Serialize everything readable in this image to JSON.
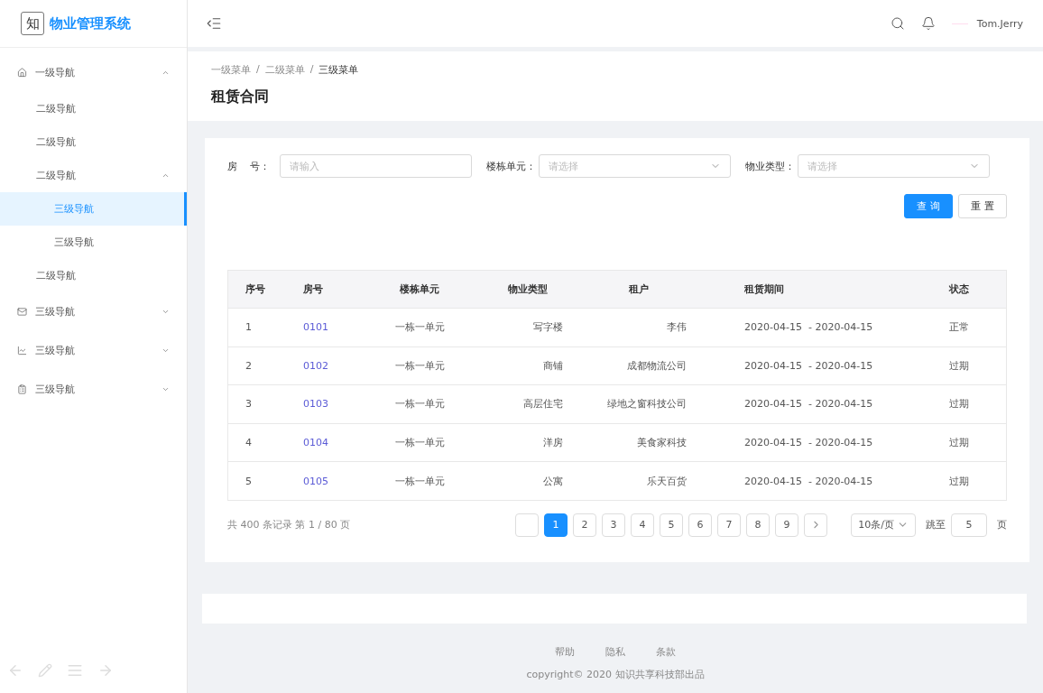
{
  "brand": {
    "logo": "知",
    "title": "物业管理系统"
  },
  "sidebar": {
    "items": [
      {
        "label": "一级导航",
        "expanded": true,
        "selected": false,
        "children": [
          {
            "label": "二级导航",
            "selected": false
          },
          {
            "label": "二级导航",
            "selected": false
          },
          {
            "label": "二级导航",
            "expanded": true,
            "selected": false,
            "children": [
              {
                "label": "三级导航",
                "selected": true
              },
              {
                "label": "三级导航",
                "selected": false
              }
            ]
          },
          {
            "label": "二级导航",
            "selected": false
          }
        ]
      },
      {
        "label": "三级导航",
        "expanded": false,
        "selected": false
      },
      {
        "label": "三级导航",
        "expanded": false,
        "selected": false
      },
      {
        "label": "三级导航",
        "expanded": false,
        "selected": false
      }
    ]
  },
  "header": {
    "user": "Tom.Jerry"
  },
  "breadcrumb": [
    {
      "label": "一级菜单",
      "current": false
    },
    {
      "separator": "/"
    },
    {
      "label": "二级菜单",
      "current": false
    },
    {
      "separator": "/"
    },
    {
      "label": "三级菜单",
      "current": true
    }
  ],
  "page_title": "租赁合同",
  "filters": [
    {
      "label": "房　 号：",
      "kind": "input",
      "placeholder": "请输入"
    },
    {
      "label": "楼栋单元：",
      "kind": "select",
      "placeholder": "请选择"
    },
    {
      "label": "物业类型：",
      "kind": "select",
      "placeholder": "请选择"
    }
  ],
  "buttons": [
    {
      "label": "查 询",
      "primary": true
    },
    {
      "label": "重 置",
      "primary": false
    }
  ],
  "table": {
    "columns": [
      "序号",
      "房号",
      "楼栋单元",
      "物业类型",
      "租户",
      "租赁期间",
      "状态"
    ],
    "rows": [
      [
        "1",
        "0101",
        "一栋一单元",
        "写字楼",
        "李伟",
        "2020-04-15  - 2020-04-15",
        "正常"
      ],
      [
        "2",
        "0102",
        "一栋一单元",
        "商铺",
        "成都物流公司",
        "2020-04-15  - 2020-04-15",
        "过期"
      ],
      [
        "3",
        "0103",
        "一栋一单元",
        "高层住宅",
        "绿地之窗科技公司",
        "2020-04-15  - 2020-04-15",
        "过期"
      ],
      [
        "4",
        "0104",
        "一栋一单元",
        "洋房",
        "美食家科技",
        "2020-04-15  - 2020-04-15",
        "过期"
      ],
      [
        "5",
        "0105",
        "一栋一单元",
        "公寓",
        "乐天百货",
        "2020-04-15  - 2020-04-15",
        "过期"
      ]
    ]
  },
  "pagination": {
    "summary": "共 400 条记录 第 1 / 80 页",
    "pages": [
      {
        "label": "1",
        "selected": true
      },
      {
        "label": "2",
        "selected": false
      },
      {
        "label": "3",
        "selected": false
      },
      {
        "label": "4",
        "selected": false
      },
      {
        "label": "5",
        "selected": false
      },
      {
        "label": "6",
        "selected": false
      },
      {
        "label": "7",
        "selected": false
      },
      {
        "label": "8",
        "selected": false
      },
      {
        "label": "9",
        "selected": false
      }
    ],
    "page_size": "10条/页",
    "jump_label": "跳至",
    "jump_value": "5",
    "jump_suffix": "页"
  },
  "footer": {
    "links": [
      "帮助",
      "隐私",
      "条款"
    ],
    "copyright": "copyright© 2020 知识共享科技部出品"
  }
}
